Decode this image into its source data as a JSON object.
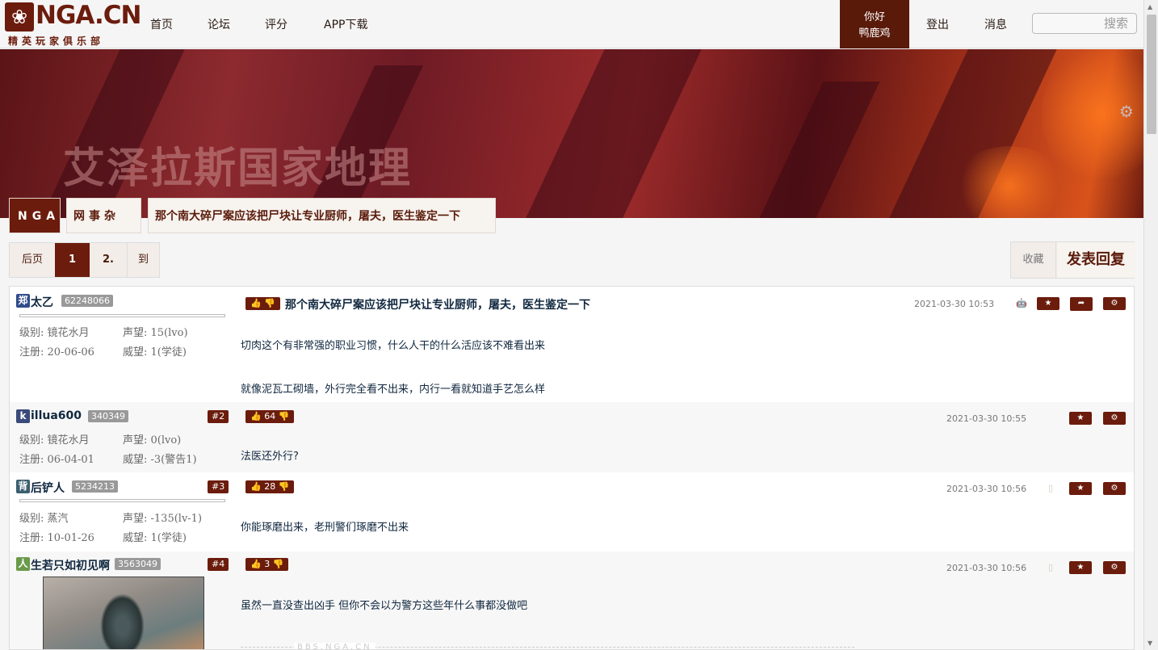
{
  "header": {
    "logo_text": "NGA.CN",
    "logo_tagline": "精英玩家俱乐部",
    "nav": [
      "首页",
      "论坛",
      "评分",
      "APP下载"
    ],
    "greeting": "你好",
    "username": "鸭鹿鸡",
    "logout": "登出",
    "messages": "消息",
    "search_placeholder": "搜索"
  },
  "banner": {
    "title": "艾泽拉斯国家地理"
  },
  "breadcrumb": {
    "site": "NGA",
    "board": "网事杂谈",
    "topic": "那个南大碎尸案应该把尸块让专业厨师，屠夫，医生鉴定一下"
  },
  "pager": {
    "prev": "后页",
    "current": "1",
    "next": "2.",
    "goto": "到"
  },
  "thread_actions": {
    "favorite": "收藏",
    "reply": "发表回复"
  },
  "posts": [
    {
      "badge": "郑",
      "badge_color": "#2f4b8a",
      "name": "太乙",
      "uid": "62248066",
      "level_label": "级别: 镜花水月",
      "reputation": "声望: 15(lvo)",
      "registered": "注册: 20-06-06",
      "prestige": "威望: 1(学徒)",
      "title": "那个南大碎尸案应该把尸块让专业厨师，屠夫，医生鉴定一下",
      "date": "2021-03-30 10:53",
      "lines": [
        "切肉这个有非常强的职业习惯，什么人干的什么活应该不难看出来",
        "就像泥瓦工砌墙，外行完全看不出来，内行一看就知道手艺怎么样"
      ]
    },
    {
      "badge": "k",
      "badge_color": "#3a4a7a",
      "name": "illua600",
      "uid": "340349",
      "floor": "#2",
      "level_label": "级别: 镜花水月",
      "reputation": "声望: 0(lvo)",
      "registered": "注册: 06-04-01",
      "prestige": "威望: -3(警告1)",
      "votes": "64",
      "date": "2021-03-30 10:55",
      "lines": [
        "法医还外行?"
      ]
    },
    {
      "badge": "背",
      "badge_color": "#3b5f6e",
      "name": "后铲人",
      "uid": "5234213",
      "floor": "#3",
      "level_label": "级别: 蒸汽",
      "reputation": "声望: -135(lv-1)",
      "registered": "注册: 10-01-26",
      "prestige": "威望: 1(学徒)",
      "votes": "28",
      "date": "2021-03-30 10:56",
      "lines": [
        "你能琢磨出来，老刑警们琢磨不出来"
      ]
    },
    {
      "badge": "人",
      "badge_color": "#6a9a4a",
      "name": "生若只如初见啊",
      "uid": "3563049",
      "floor": "#4",
      "votes": "3",
      "date": "2021-03-30 10:56",
      "lines": [
        "虽然一直没查出凶手 但你不会以为警方这些年什么事都没做吧"
      ],
      "watermark": "BBS.NGA.CN"
    }
  ]
}
